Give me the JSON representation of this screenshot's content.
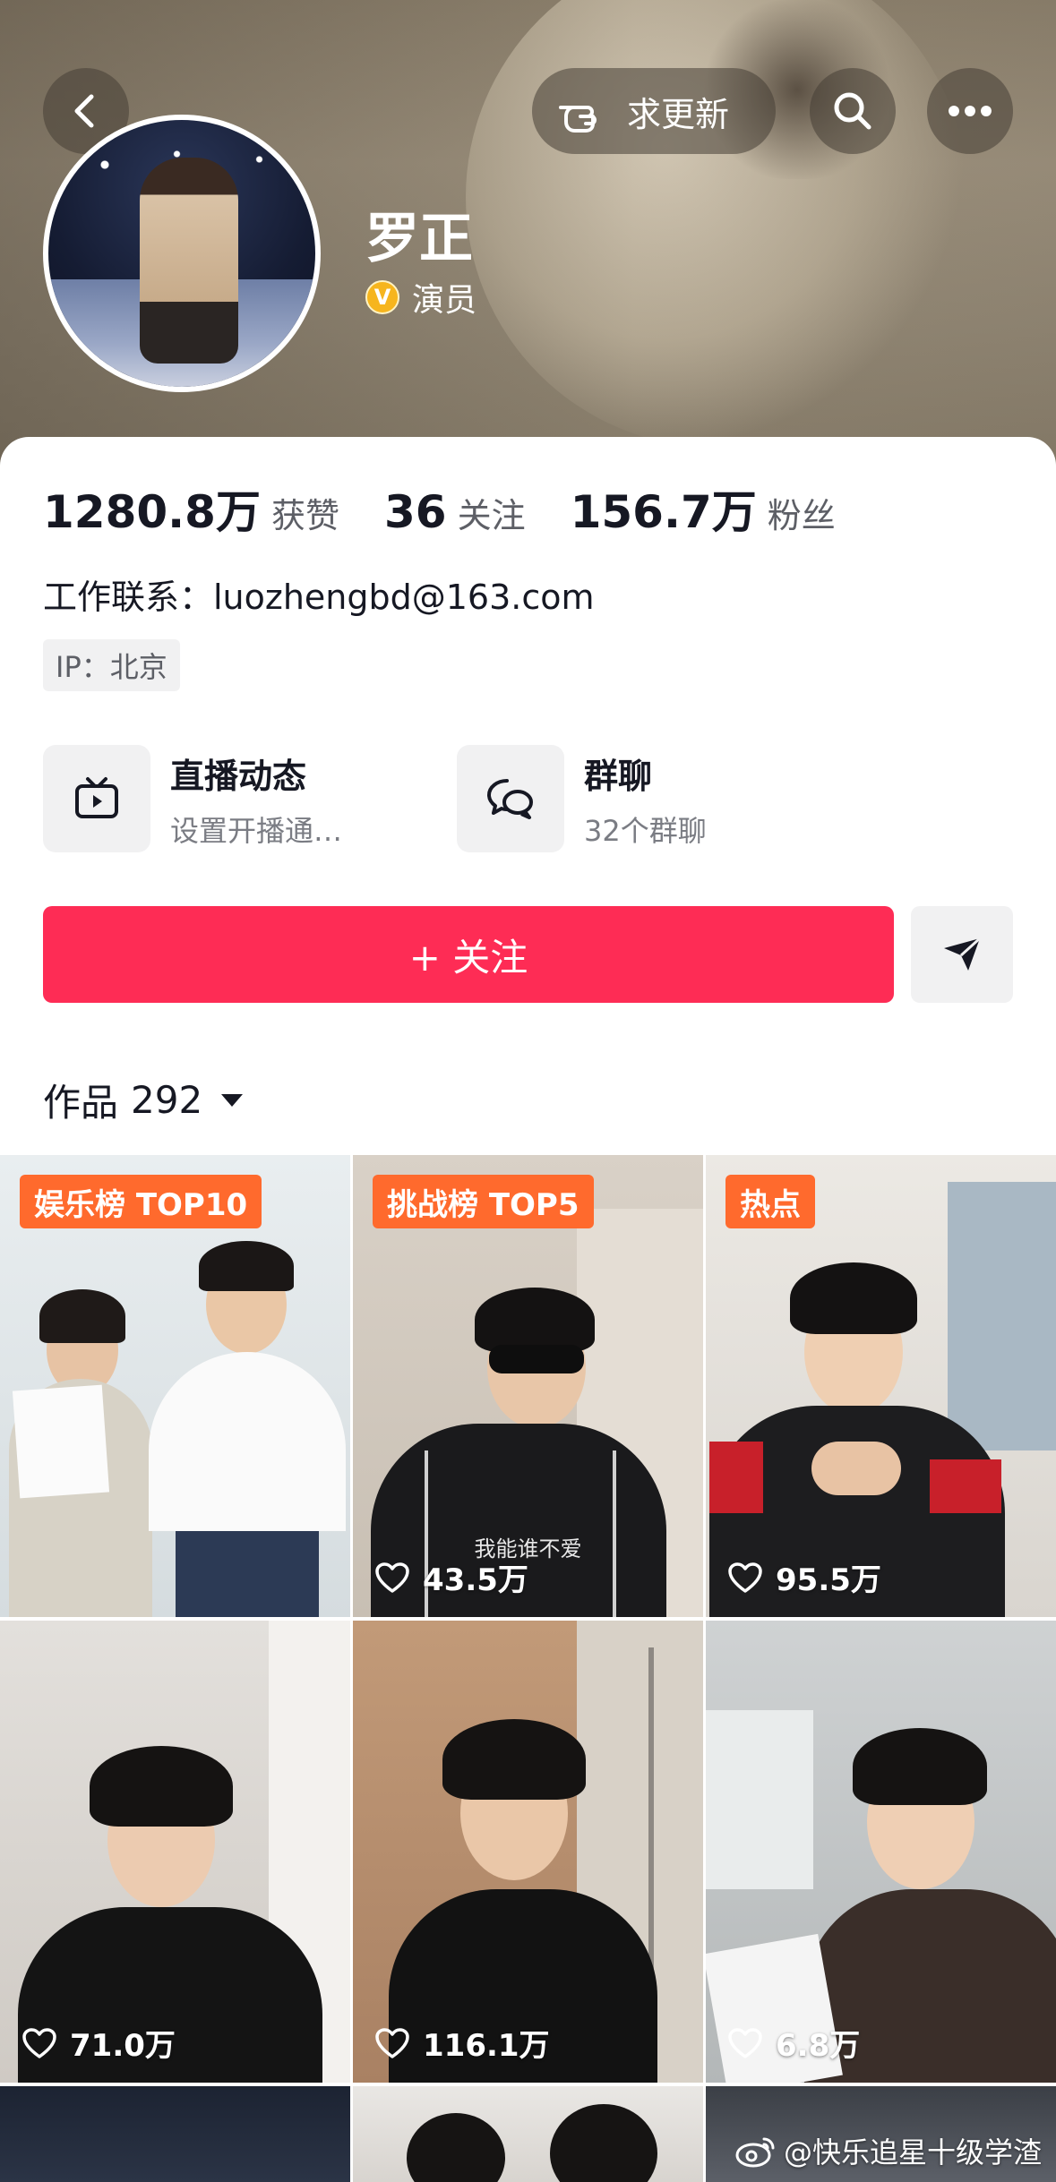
{
  "header": {
    "request_update_label": "求更新",
    "name": "罗正",
    "verified_badge_letter": "V",
    "verified_role": "演员"
  },
  "stats": [
    {
      "value": "1280.8万",
      "label": "获赞"
    },
    {
      "value": "36",
      "label": "关注"
    },
    {
      "value": "156.7万",
      "label": "粉丝"
    }
  ],
  "bio": {
    "contact": "工作联系：luozhengbd@163.com",
    "ip": "IP：北京"
  },
  "features": [
    {
      "icon": "tv-icon",
      "title": "直播动态",
      "subtitle": "设置开播通…"
    },
    {
      "icon": "group-chat-icon",
      "title": "群聊",
      "subtitle": "32个群聊"
    }
  ],
  "follow_button": "+ 关注",
  "works": {
    "label": "作品",
    "count": "292"
  },
  "videos": [
    {
      "badge": "娱乐榜 TOP10",
      "likes": "",
      "caption": ""
    },
    {
      "badge": "挑战榜 TOP5",
      "likes": "43.5万",
      "caption": "我能谁不爱"
    },
    {
      "badge": "热点",
      "likes": "95.5万",
      "caption": ""
    },
    {
      "badge": "",
      "likes": "71.0万",
      "caption": ""
    },
    {
      "badge": "",
      "likes": "116.1万",
      "caption": ""
    },
    {
      "badge": "",
      "likes": "6.8万",
      "caption": ""
    }
  ],
  "watermark": "@快乐追星十级学渣",
  "colors": {
    "accent": "#fe2c55",
    "badge": "#ff6a2d"
  }
}
